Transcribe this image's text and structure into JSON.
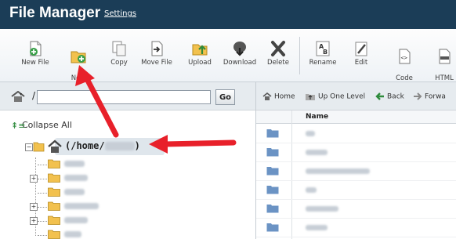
{
  "header": {
    "title": "File Manager",
    "settings_label": "Settings"
  },
  "toolbar": {
    "items": [
      {
        "label": "New File",
        "icon": "new-file-icon"
      },
      {
        "label": "New\nFolder",
        "icon": "new-folder-icon"
      },
      {
        "label": "Copy",
        "icon": "copy-icon"
      },
      {
        "label": "Move File",
        "icon": "move-file-icon"
      },
      {
        "label": "Upload",
        "icon": "upload-icon"
      },
      {
        "label": "Download",
        "icon": "download-icon"
      },
      {
        "label": "Delete",
        "icon": "delete-icon"
      },
      {
        "label": "Rename",
        "icon": "rename-icon"
      },
      {
        "label": "Edit",
        "icon": "edit-icon"
      },
      {
        "label": "Code\nEditor",
        "icon": "code-editor-icon"
      },
      {
        "label": "HTML\nEditor",
        "icon": "html-editor-icon"
      }
    ]
  },
  "left_panel": {
    "path_prefix": "/",
    "path_value": "",
    "go_label": "Go",
    "collapse_label": "Collapse All",
    "root_label_prefix": "(/home/",
    "root_label_suffix": ")"
  },
  "right_panel": {
    "nav": {
      "home_label": "Home",
      "up_label": "Up One Level",
      "back_label": "Back",
      "forward_label": "Forwa"
    },
    "column_name": "Name"
  },
  "colors": {
    "header_bg": "#1b3d57",
    "arrow": "#e8202a",
    "folder": "#f2c14e",
    "file_folder": "#6b93c4"
  }
}
